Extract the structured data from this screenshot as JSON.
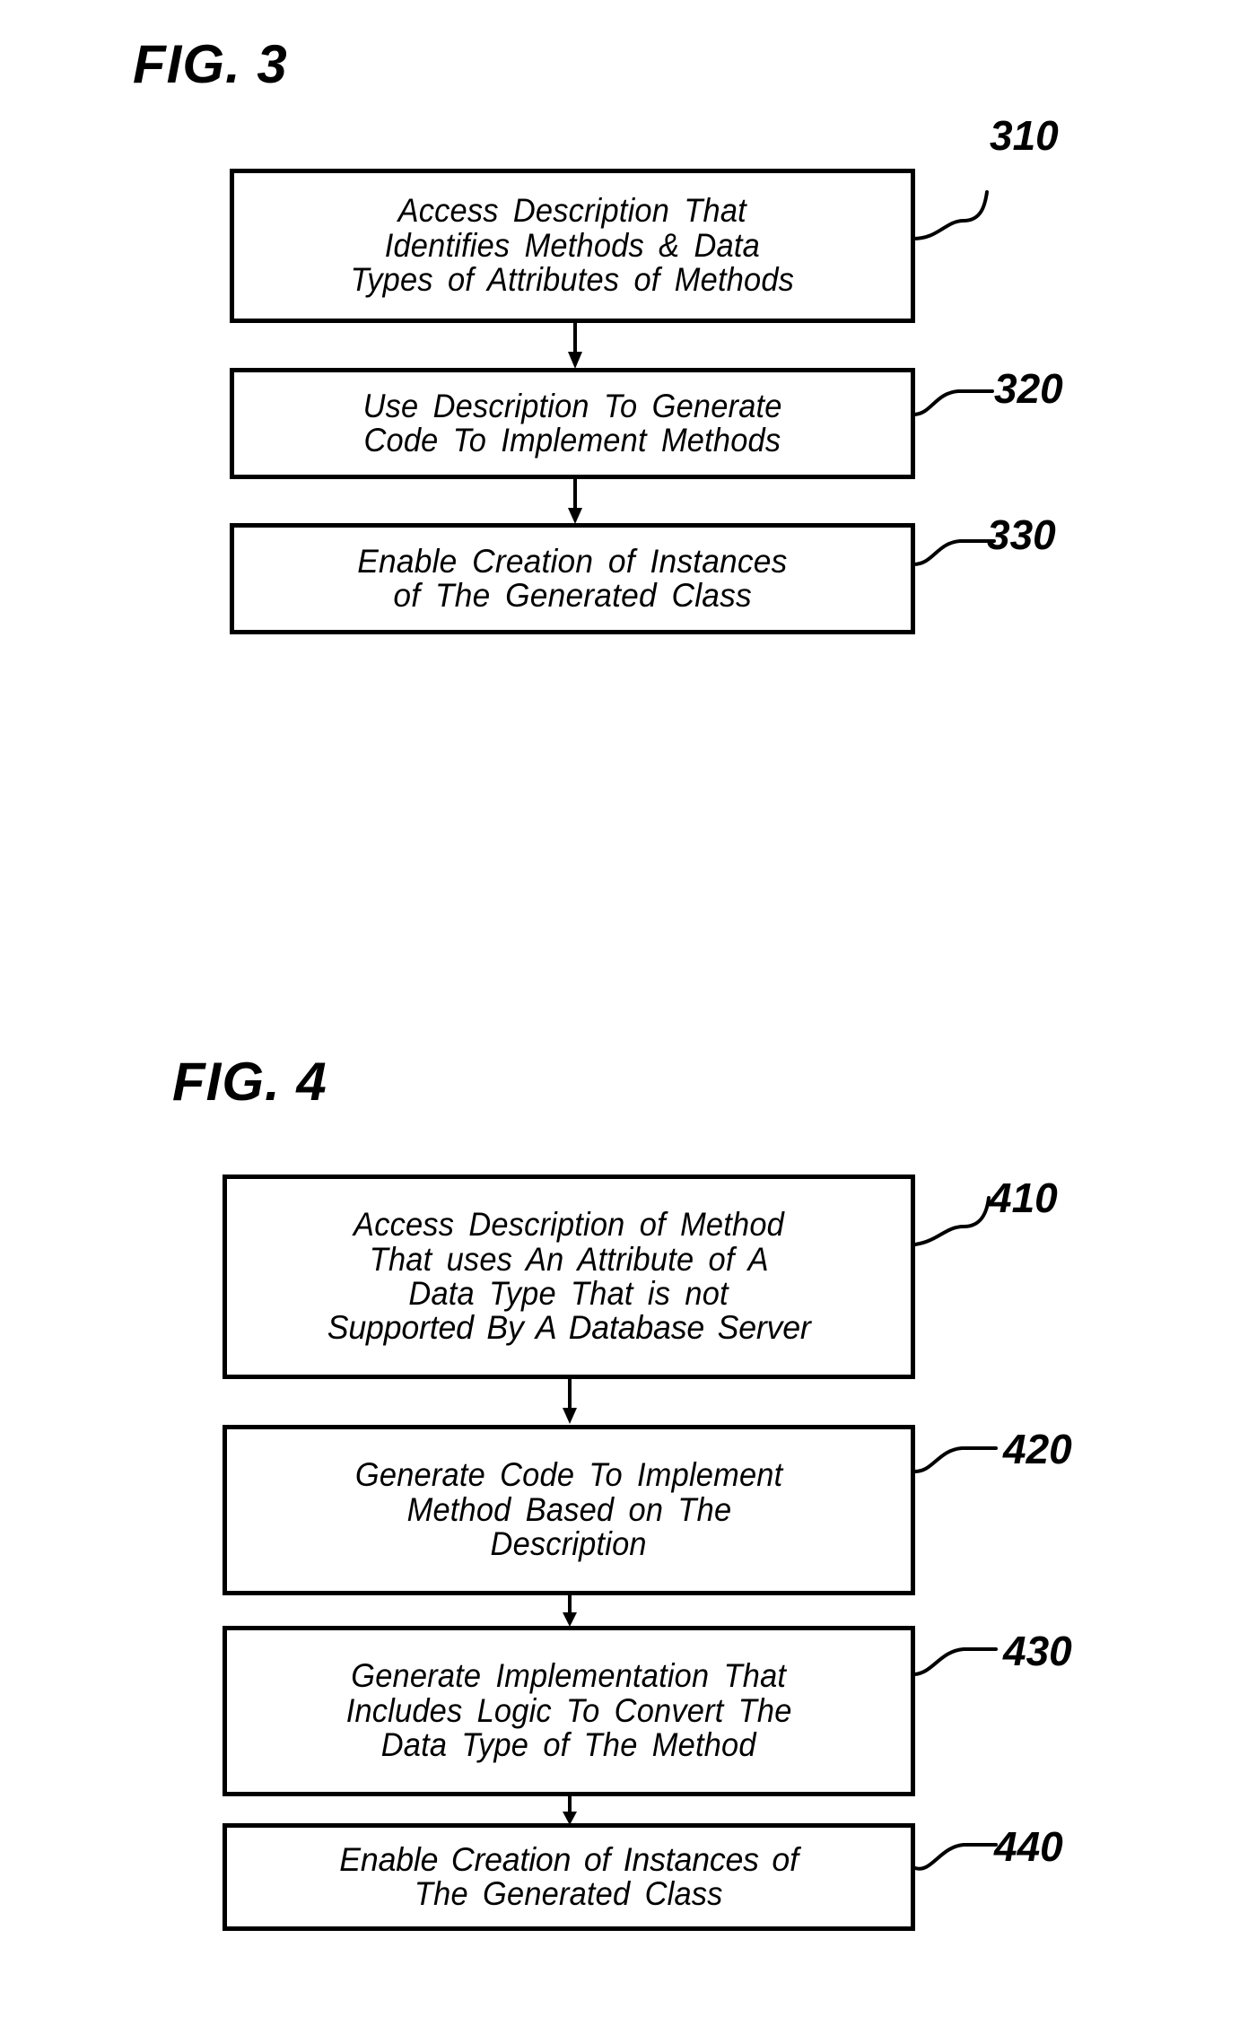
{
  "document": {
    "type": "patent-flowchart-sheet",
    "background_color": "#ffffff",
    "ink_color": "#000000"
  },
  "figures": [
    {
      "id": "fig3",
      "title": "FIG.  3",
      "ref_prefix": "3",
      "boxes": [
        {
          "ref": "310",
          "lines": [
            "Access Description That",
            "Identifies Methods & Data",
            "Types of Attributes of Methods"
          ]
        },
        {
          "ref": "320",
          "lines": [
            "Use Description To Generate",
            "Code To Implement Methods"
          ]
        },
        {
          "ref": "330",
          "lines": [
            "Enable Creation of Instances",
            "of The Generated Class"
          ]
        }
      ],
      "connectors": [
        {
          "from": "310",
          "to": "320",
          "kind": "down-arrow"
        },
        {
          "from": "320",
          "to": "330",
          "kind": "down-arrow"
        }
      ]
    },
    {
      "id": "fig4",
      "title": "FIG.  4",
      "ref_prefix": "4",
      "boxes": [
        {
          "ref": "410",
          "lines": [
            "Access Description of Method",
            "That uses An Attribute of A",
            "Data Type That is not",
            "Supported By A Database Server"
          ]
        },
        {
          "ref": "420",
          "lines": [
            "Generate Code To Implement",
            "Method Based on The",
            "Description"
          ]
        },
        {
          "ref": "430",
          "lines": [
            "Generate Implementation That",
            "Includes Logic To Convert The",
            "Data Type of The Method"
          ]
        },
        {
          "ref": "440",
          "lines": [
            "Enable Creation of Instances of",
            "The Generated Class"
          ]
        }
      ],
      "connectors": [
        {
          "from": "410",
          "to": "420",
          "kind": "down-arrow"
        },
        {
          "from": "420",
          "to": "430",
          "kind": "down-arrow"
        },
        {
          "from": "430",
          "to": "440",
          "kind": "down-arrow"
        }
      ]
    }
  ]
}
